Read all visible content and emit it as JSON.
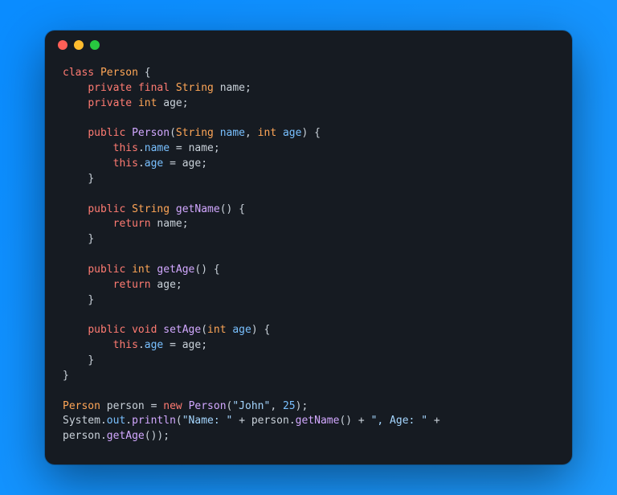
{
  "window": {
    "controls": [
      "close",
      "minimize",
      "zoom"
    ]
  },
  "code": {
    "language": "java",
    "tokens": [
      [
        {
          "t": "kw",
          "v": "class"
        },
        {
          "t": "sp",
          "v": " "
        },
        {
          "t": "type",
          "v": "Person"
        },
        {
          "t": "sp",
          "v": " "
        },
        {
          "t": "punc",
          "v": "{"
        }
      ],
      [
        {
          "t": "sp",
          "v": "    "
        },
        {
          "t": "kw",
          "v": "private"
        },
        {
          "t": "sp",
          "v": " "
        },
        {
          "t": "mod",
          "v": "final"
        },
        {
          "t": "sp",
          "v": " "
        },
        {
          "t": "type",
          "v": "String"
        },
        {
          "t": "sp",
          "v": " "
        },
        {
          "t": "id",
          "v": "name"
        },
        {
          "t": "punc",
          "v": ";"
        }
      ],
      [
        {
          "t": "sp",
          "v": "    "
        },
        {
          "t": "kw",
          "v": "private"
        },
        {
          "t": "sp",
          "v": " "
        },
        {
          "t": "type",
          "v": "int"
        },
        {
          "t": "sp",
          "v": " "
        },
        {
          "t": "id",
          "v": "age"
        },
        {
          "t": "punc",
          "v": ";"
        }
      ],
      [],
      [
        {
          "t": "sp",
          "v": "    "
        },
        {
          "t": "kw",
          "v": "public"
        },
        {
          "t": "sp",
          "v": " "
        },
        {
          "t": "fn",
          "v": "Person"
        },
        {
          "t": "punc",
          "v": "("
        },
        {
          "t": "type",
          "v": "String"
        },
        {
          "t": "sp",
          "v": " "
        },
        {
          "t": "var",
          "v": "name"
        },
        {
          "t": "punc",
          "v": ", "
        },
        {
          "t": "type",
          "v": "int"
        },
        {
          "t": "sp",
          "v": " "
        },
        {
          "t": "var",
          "v": "age"
        },
        {
          "t": "punc",
          "v": ") {"
        }
      ],
      [
        {
          "t": "sp",
          "v": "        "
        },
        {
          "t": "kw",
          "v": "this"
        },
        {
          "t": "punc",
          "v": "."
        },
        {
          "t": "var",
          "v": "name"
        },
        {
          "t": "sp",
          "v": " "
        },
        {
          "t": "punc",
          "v": "="
        },
        {
          "t": "sp",
          "v": " "
        },
        {
          "t": "id",
          "v": "name"
        },
        {
          "t": "punc",
          "v": ";"
        }
      ],
      [
        {
          "t": "sp",
          "v": "        "
        },
        {
          "t": "kw",
          "v": "this"
        },
        {
          "t": "punc",
          "v": "."
        },
        {
          "t": "var",
          "v": "age"
        },
        {
          "t": "sp",
          "v": " "
        },
        {
          "t": "punc",
          "v": "="
        },
        {
          "t": "sp",
          "v": " "
        },
        {
          "t": "id",
          "v": "age"
        },
        {
          "t": "punc",
          "v": ";"
        }
      ],
      [
        {
          "t": "sp",
          "v": "    "
        },
        {
          "t": "punc",
          "v": "}"
        }
      ],
      [],
      [
        {
          "t": "sp",
          "v": "    "
        },
        {
          "t": "kw",
          "v": "public"
        },
        {
          "t": "sp",
          "v": " "
        },
        {
          "t": "type",
          "v": "String"
        },
        {
          "t": "sp",
          "v": " "
        },
        {
          "t": "fn",
          "v": "getName"
        },
        {
          "t": "punc",
          "v": "() {"
        }
      ],
      [
        {
          "t": "sp",
          "v": "        "
        },
        {
          "t": "kw",
          "v": "return"
        },
        {
          "t": "sp",
          "v": " "
        },
        {
          "t": "id",
          "v": "name"
        },
        {
          "t": "punc",
          "v": ";"
        }
      ],
      [
        {
          "t": "sp",
          "v": "    "
        },
        {
          "t": "punc",
          "v": "}"
        }
      ],
      [],
      [
        {
          "t": "sp",
          "v": "    "
        },
        {
          "t": "kw",
          "v": "public"
        },
        {
          "t": "sp",
          "v": " "
        },
        {
          "t": "type",
          "v": "int"
        },
        {
          "t": "sp",
          "v": " "
        },
        {
          "t": "fn",
          "v": "getAge"
        },
        {
          "t": "punc",
          "v": "() {"
        }
      ],
      [
        {
          "t": "sp",
          "v": "        "
        },
        {
          "t": "kw",
          "v": "return"
        },
        {
          "t": "sp",
          "v": " "
        },
        {
          "t": "id",
          "v": "age"
        },
        {
          "t": "punc",
          "v": ";"
        }
      ],
      [
        {
          "t": "sp",
          "v": "    "
        },
        {
          "t": "punc",
          "v": "}"
        }
      ],
      [],
      [
        {
          "t": "sp",
          "v": "    "
        },
        {
          "t": "kw",
          "v": "public"
        },
        {
          "t": "sp",
          "v": " "
        },
        {
          "t": "kw",
          "v": "void"
        },
        {
          "t": "sp",
          "v": " "
        },
        {
          "t": "fn",
          "v": "setAge"
        },
        {
          "t": "punc",
          "v": "("
        },
        {
          "t": "type",
          "v": "int"
        },
        {
          "t": "sp",
          "v": " "
        },
        {
          "t": "var",
          "v": "age"
        },
        {
          "t": "punc",
          "v": ") {"
        }
      ],
      [
        {
          "t": "sp",
          "v": "        "
        },
        {
          "t": "kw",
          "v": "this"
        },
        {
          "t": "punc",
          "v": "."
        },
        {
          "t": "var",
          "v": "age"
        },
        {
          "t": "sp",
          "v": " "
        },
        {
          "t": "punc",
          "v": "="
        },
        {
          "t": "sp",
          "v": " "
        },
        {
          "t": "id",
          "v": "age"
        },
        {
          "t": "punc",
          "v": ";"
        }
      ],
      [
        {
          "t": "sp",
          "v": "    "
        },
        {
          "t": "punc",
          "v": "}"
        }
      ],
      [
        {
          "t": "punc",
          "v": "}"
        }
      ],
      [],
      [
        {
          "t": "type",
          "v": "Person"
        },
        {
          "t": "sp",
          "v": " "
        },
        {
          "t": "id",
          "v": "person"
        },
        {
          "t": "sp",
          "v": " "
        },
        {
          "t": "punc",
          "v": "="
        },
        {
          "t": "sp",
          "v": " "
        },
        {
          "t": "kw",
          "v": "new"
        },
        {
          "t": "sp",
          "v": " "
        },
        {
          "t": "fn",
          "v": "Person"
        },
        {
          "t": "punc",
          "v": "("
        },
        {
          "t": "str",
          "v": "\"John\""
        },
        {
          "t": "punc",
          "v": ", "
        },
        {
          "t": "num",
          "v": "25"
        },
        {
          "t": "punc",
          "v": ");"
        }
      ],
      [
        {
          "t": "id",
          "v": "System"
        },
        {
          "t": "punc",
          "v": "."
        },
        {
          "t": "var",
          "v": "out"
        },
        {
          "t": "punc",
          "v": "."
        },
        {
          "t": "fn",
          "v": "println"
        },
        {
          "t": "punc",
          "v": "("
        },
        {
          "t": "str",
          "v": "\"Name: \""
        },
        {
          "t": "sp",
          "v": " "
        },
        {
          "t": "punc",
          "v": "+"
        },
        {
          "t": "sp",
          "v": " "
        },
        {
          "t": "id",
          "v": "person"
        },
        {
          "t": "punc",
          "v": "."
        },
        {
          "t": "fn",
          "v": "getName"
        },
        {
          "t": "punc",
          "v": "()"
        },
        {
          "t": "sp",
          "v": " "
        },
        {
          "t": "punc",
          "v": "+"
        },
        {
          "t": "sp",
          "v": " "
        },
        {
          "t": "str",
          "v": "\", Age: \""
        },
        {
          "t": "sp",
          "v": " "
        },
        {
          "t": "punc",
          "v": "+"
        },
        {
          "t": "sp",
          "v": " "
        }
      ],
      [
        {
          "t": "id",
          "v": "person"
        },
        {
          "t": "punc",
          "v": "."
        },
        {
          "t": "fn",
          "v": "getAge"
        },
        {
          "t": "punc",
          "v": "());"
        }
      ]
    ]
  }
}
